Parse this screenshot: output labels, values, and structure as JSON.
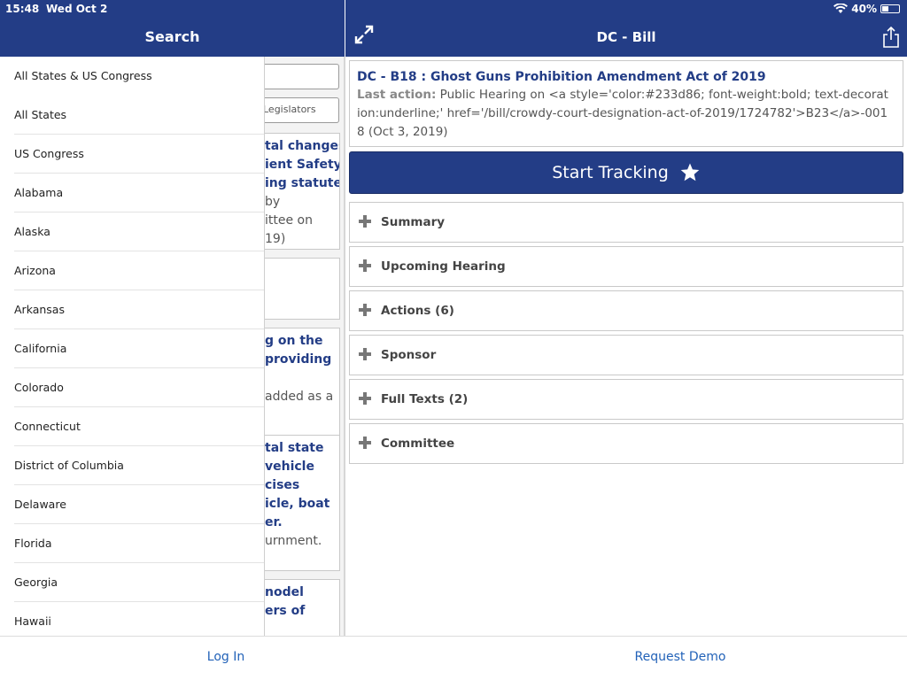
{
  "status_bar": {
    "time": "15:48",
    "date": "Wed Oct 2",
    "battery": "40%",
    "battery_level": 0.4
  },
  "left_header": {
    "title": "Search"
  },
  "right_header": {
    "title": "DC - Bill"
  },
  "background_list": {
    "search_input_placeholder": "",
    "legislators_input_text": "Legislators",
    "cards": [
      {
        "lines": [
          {
            "text": "tal changes",
            "bold": true
          },
          {
            "text": "ient Safety",
            "bold": true
          },
          {
            "text": "ing statute",
            "bold": true
          },
          {
            "text": "by",
            "bold": false
          },
          {
            "text": "ittee on",
            "bold": false
          },
          {
            "text": "19)",
            "bold": false
          }
        ]
      },
      {
        "lines": []
      },
      {
        "lines": [
          {
            "text": "g on the",
            "bold": true
          },
          {
            "text": "providing",
            "bold": true
          },
          {
            "text": "",
            "bold": false
          },
          {
            "text": "added as a",
            "bold": false
          }
        ]
      },
      {
        "lines": [
          {
            "text": "tal state",
            "bold": true
          },
          {
            "text": "vehicle",
            "bold": true
          },
          {
            "text": "cises",
            "bold": true
          },
          {
            "text": "icle, boat",
            "bold": true
          },
          {
            "text": "er.",
            "bold": true
          },
          {
            "text": "urnment.",
            "bold": false
          }
        ]
      },
      {
        "lines": [
          {
            "text": "nodel",
            "bold": true
          },
          {
            "text": "ers of",
            "bold": true
          }
        ]
      }
    ]
  },
  "drawer": {
    "items": [
      "All States & US Congress",
      "All States",
      "US Congress",
      "Alabama",
      "Alaska",
      "Arizona",
      "Arkansas",
      "California",
      "Colorado",
      "Connecticut",
      "District of Columbia",
      "Delaware",
      "Florida",
      "Georgia",
      "Hawaii"
    ]
  },
  "bill": {
    "title": "DC - B18 : Ghost Guns Prohibition Amendment Act of 2019",
    "last_action_label": "Last action:",
    "last_action_text": " Public Hearing on <a style='color:#233d86; font-weight:bold; text-decoration:underline;' href='/bill/crowdy-court-designation-act-of-2019/1724782'>B23</a>-0018 (Oct 3, 2019)"
  },
  "track_button": {
    "label": "Start Tracking"
  },
  "sections": [
    "Summary",
    "Upcoming Hearing",
    "Actions (6)",
    "Sponsor",
    "Full Texts (2)",
    "Committee"
  ],
  "bottom_bar": {
    "login_label": "Log In",
    "demo_label": "Request Demo"
  },
  "colors": {
    "brand": "#233d86",
    "link": "#2262b8"
  }
}
